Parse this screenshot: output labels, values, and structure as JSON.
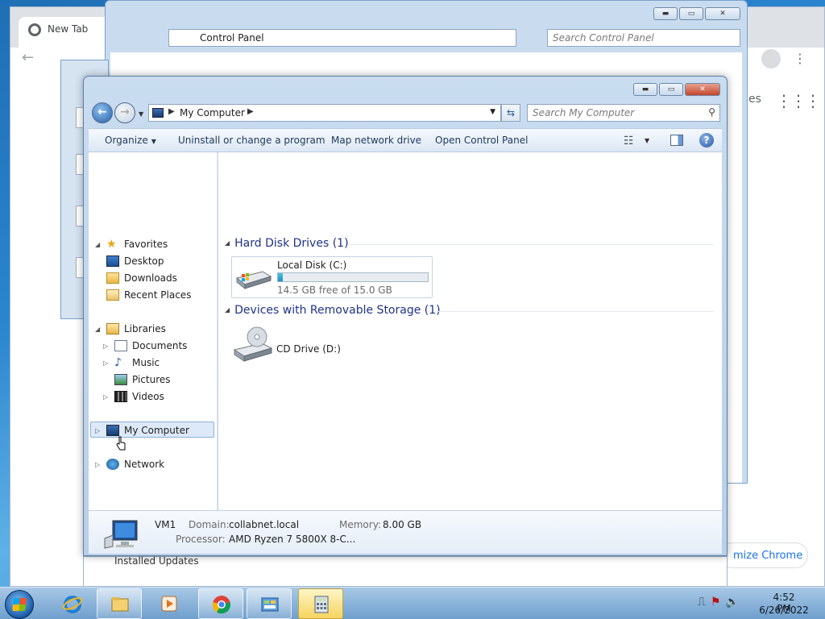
{
  "chrome": {
    "tab_title": "New Tab",
    "customize_label": "mize Chrome",
    "side_snippet": "es"
  },
  "control_panel": {
    "address_label": "Control Panel",
    "search_placeholder": "Search Control Panel"
  },
  "behind_window": {
    "installed_updates": "Installed Updates"
  },
  "explorer": {
    "address_label": "My Computer",
    "search_placeholder": "Search My Computer",
    "toolbar": {
      "organize": "Organize",
      "uninstall": "Uninstall or change a program",
      "map_drive": "Map network drive",
      "open_control_panel": "Open Control Panel"
    },
    "nav": {
      "favorites": "Favorites",
      "desktop": "Desktop",
      "downloads": "Downloads",
      "recent_places": "Recent Places",
      "libraries": "Libraries",
      "documents": "Documents",
      "music": "Music",
      "pictures": "Pictures",
      "videos": "Videos",
      "my_computer": "My Computer",
      "network": "Network"
    },
    "groups": {
      "hdd_title": "Hard Disk Drives (1)",
      "removable_title": "Devices with Removable Storage (1)"
    },
    "local_disk": {
      "name": "Local Disk (C:)",
      "free_text": "14.5 GB free of 15.0 GB",
      "used_fraction": 0.033
    },
    "cd_drive": {
      "name": "CD Drive (D:)"
    },
    "details": {
      "computer_name": "VM1",
      "domain_label": "Domain:",
      "domain_value": "collabnet.local",
      "memory_label": "Memory:",
      "memory_value": "8.00 GB",
      "processor_label": "Processor:",
      "processor_value": "AMD Ryzen 7 5800X 8-C..."
    }
  },
  "taskbar": {
    "time": "4:52 PM",
    "date": "6/26/2022"
  },
  "colors": {
    "group_title": "#1e3287",
    "selection": "#dde9f8",
    "taskbar_active": "#f5d45e"
  }
}
